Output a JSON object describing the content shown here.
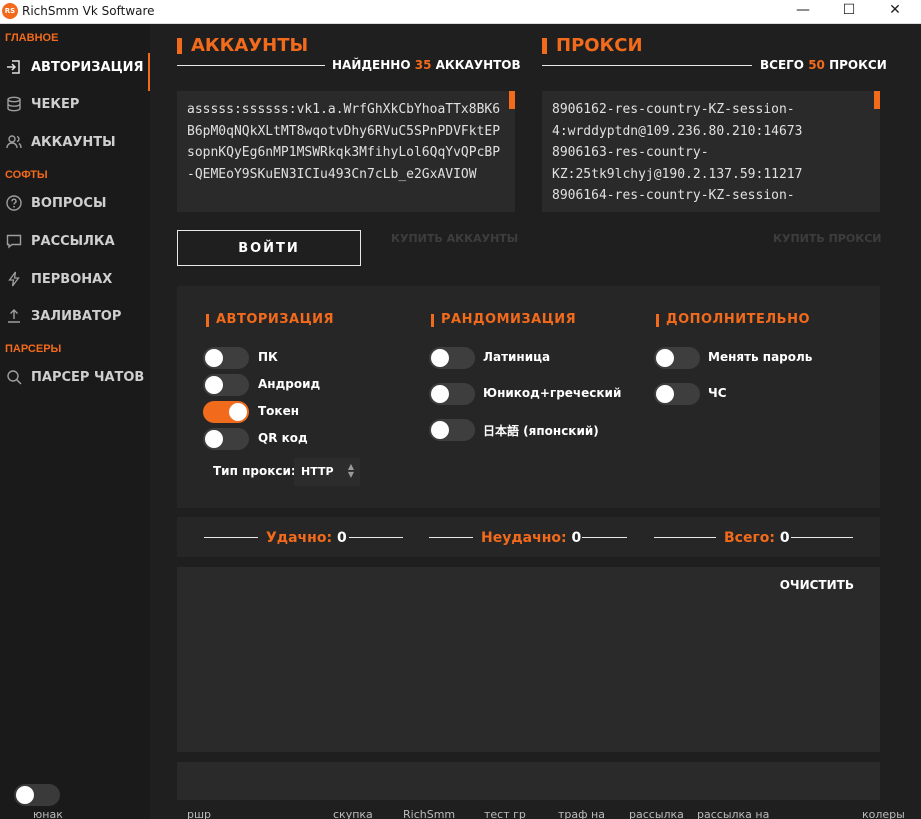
{
  "window": {
    "logo_text": "RS",
    "title": "RichSmm Vk Software",
    "minimize_glyph": "—",
    "maximize_glyph": "☐",
    "close_glyph": "✕"
  },
  "sidebar": {
    "section_main": "ГЛАВНОЕ",
    "section_soft": "СОФТЫ",
    "section_parsers": "ПАРСЕРЫ",
    "items": [
      {
        "label": "АВТОРИЗАЦИЯ",
        "icon": "login-icon",
        "active": true
      },
      {
        "label": "ЧЕКЕР",
        "icon": "database-icon"
      },
      {
        "label": "АККАУНТЫ",
        "icon": "users-icon"
      },
      {
        "label": "ВОПРОСЫ",
        "icon": "question-icon"
      },
      {
        "label": "РАССЫЛКА",
        "icon": "chat-icon"
      },
      {
        "label": "ПЕРВОНАХ",
        "icon": "lightning-icon"
      },
      {
        "label": "ЗАЛИВАТОР",
        "icon": "upload-icon"
      },
      {
        "label": "ПАРСЕР ЧАТОВ",
        "icon": "search-icon"
      }
    ]
  },
  "accounts": {
    "title": "АККАУНТЫ",
    "found_prefix": "НАЙДЕННО",
    "found_count": "35",
    "found_suffix": "АККАУНТОВ",
    "text": "asssss:ssssss:vk1.a.WrfGhXkCbYhoaTTx8BK6B6pM0qNQkXLtMT8wqotvDhy6RVuC5SPnPDVFktEPsopnKQyEg6nMP1MSWRkqk3MfihyLol6QqYvQPcBP-QEMEoY9SKuEN3ICIu493Cn7cLb_e2GxAVIOW",
    "buy_label": "КУПИТЬ АККАУНТЫ"
  },
  "proxy": {
    "title": "ПРОКСИ",
    "total_prefix": "ВСЕГО",
    "total_count": "50",
    "total_suffix": "ПРОКСИ",
    "lines": [
      "8906162-res-country-KZ-session-",
      "4:wrddyptdn@109.236.80.210:14673",
      "8906163-res-country-",
      "KZ:25tk9lchyj@190.2.137.59:11217",
      "8906164-res-country-KZ-session-"
    ],
    "buy_label": "КУПИТЬ ПРОКСИ"
  },
  "login_button": "ВОЙТИ",
  "options": {
    "auth_title": "АВТОРИЗАЦИЯ",
    "auth": [
      {
        "label": "ПК",
        "on": false
      },
      {
        "label": "Андроид",
        "on": false
      },
      {
        "label": "Токен",
        "on": true
      },
      {
        "label": "QR код",
        "on": false
      }
    ],
    "proxy_type_label": "Тип прокси:",
    "proxy_type_value": "HTTP",
    "random_title": "РАНДОМИЗАЦИЯ",
    "random": [
      {
        "label": "Латиница",
        "on": false
      },
      {
        "label": "Юникод+греческий",
        "on": false
      },
      {
        "label": "日本語 (японский)",
        "on": false
      }
    ],
    "extra_title": "ДОПОЛНИТЕЛЬНО",
    "extra": [
      {
        "label": "Менять пароль",
        "on": false
      },
      {
        "label": "ЧС",
        "on": false
      }
    ]
  },
  "stats": {
    "success_label": "Удачно:",
    "success_value": "0",
    "fail_label": "Неудачно:",
    "fail_value": "0",
    "total_label": "Всего:",
    "total_value": "0"
  },
  "log": {
    "clear_label": "ОЧИСТИТЬ"
  },
  "colors": {
    "accent": "#f26a1b",
    "background": "#1f1f1f",
    "panel": "#2a2a2a"
  },
  "bottom_tabs": [
    "юнак",
    "ршр",
    "скупка",
    "RichSmm",
    "тест гр",
    "траф на",
    "рассылка",
    "рассылка на",
    "колеры"
  ]
}
